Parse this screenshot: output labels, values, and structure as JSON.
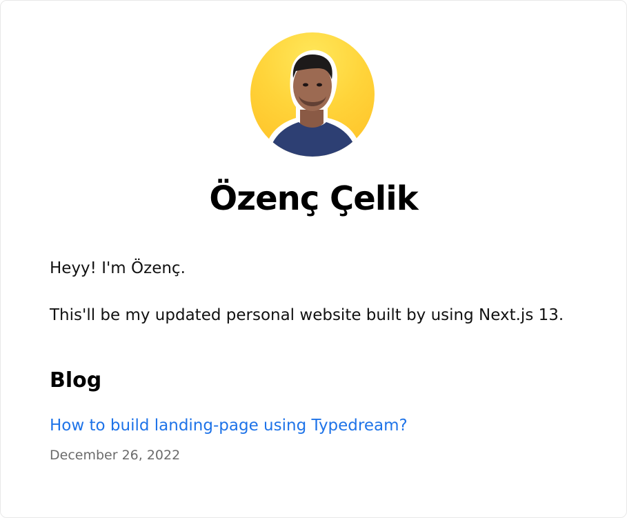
{
  "profile": {
    "name": "Özenç Çelik",
    "avatar_icon": "profile-photo"
  },
  "intro": {
    "greeting": "Heyy! I'm Özenç.",
    "description": "This'll be my updated personal website built by using Next.js 13."
  },
  "blog": {
    "heading": "Blog",
    "posts": [
      {
        "title": "How to build landing-page using Typedream?",
        "date": "December 26, 2022"
      }
    ]
  },
  "colors": {
    "link": "#1e73e8",
    "date": "#6b6b6b",
    "avatar_bg": "#ffd43a"
  }
}
